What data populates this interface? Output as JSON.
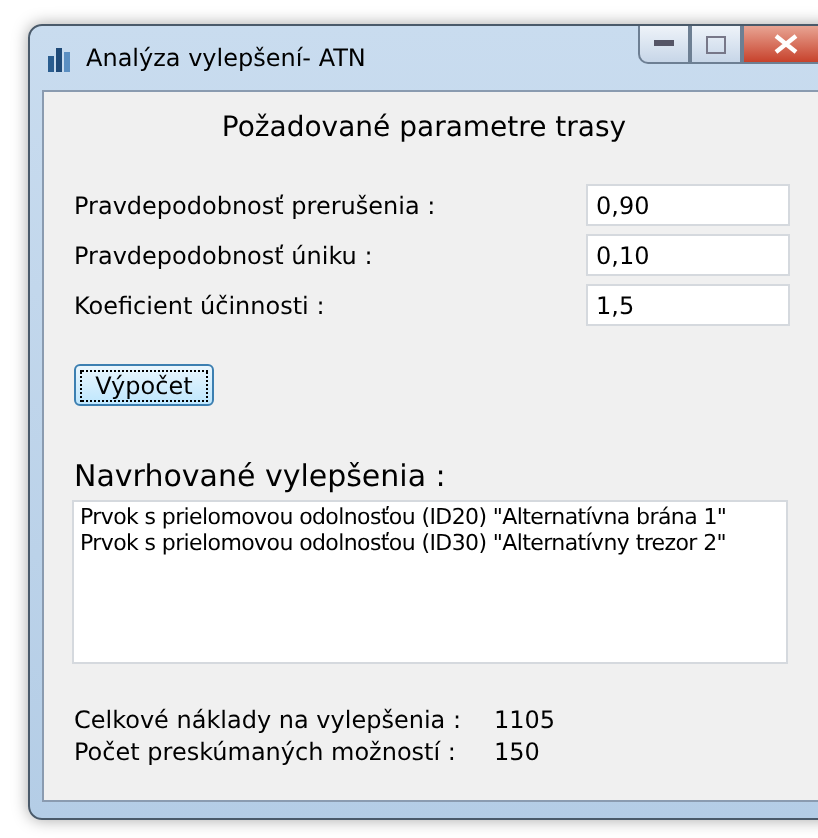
{
  "window": {
    "title": "Analýza vylepšení- ATN"
  },
  "heading": "Požadované parametre trasy",
  "params": [
    {
      "label": "Pravdepodobnosť prerušenia :",
      "value": "0,90"
    },
    {
      "label": "Pravdepodobnosť úniku :",
      "value": "0,10"
    },
    {
      "label": "Koeficient účinnosti :",
      "value": "1,5"
    }
  ],
  "compute_button": "Výpočet",
  "suggestions": {
    "title": "Navrhované vylepšenia :",
    "items": [
      "Prvok s prielomovou odolnosťou (ID20)  \"Alternatívna brána 1\"",
      "Prvok s prielomovou odolnosťou (ID30)  \"Alternatívny trezor 2\""
    ]
  },
  "summary": [
    {
      "label": "Celkové náklady na vylepšenia :",
      "value": "1105"
    },
    {
      "label": "Počet preskúmaných možností :",
      "value": "150"
    }
  ]
}
